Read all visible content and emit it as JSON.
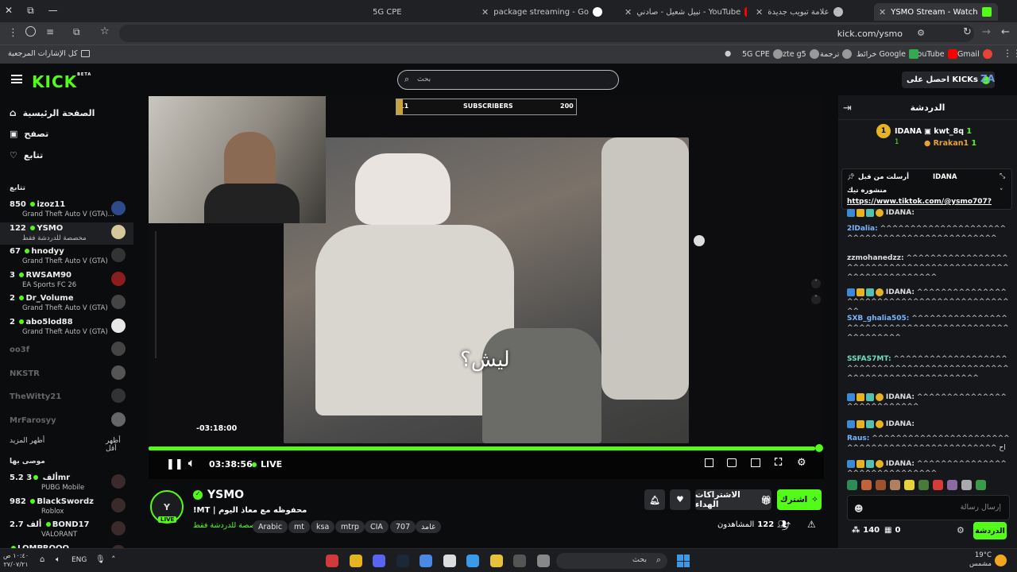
{
  "browser": {
    "tabs": [
      {
        "label": "YSMO Stream - Watch Live",
        "active": true
      },
      {
        "label": "علامة تبويب جديدة"
      },
      {
        "label": "نبيل شعيل - صادني - YouTube"
      },
      {
        "label": "package streaming - Google Se"
      },
      {
        "label": "5G CPE"
      }
    ],
    "url": "kick.com/ysmo",
    "bookmarks": [
      "Gmail",
      "YouTube",
      "خرائط Google",
      "ترجمة",
      "zte g5",
      "5G CPE"
    ],
    "bookmarks_folder": "كل الإشارات المرجعية"
  },
  "header": {
    "logo": "KICK",
    "beta": "BETA",
    "search_placeholder": "بحث",
    "get_kicks": "احصل على KICKs",
    "avatar": "ZA"
  },
  "sidebar": {
    "nav": [
      {
        "label": "الصفحة الرئيسية",
        "icon": "home-icon"
      },
      {
        "label": "تصفح",
        "icon": "browse-icon"
      },
      {
        "label": "تتابع",
        "icon": "heart-icon"
      }
    ],
    "following_title": "تتابع",
    "following": [
      {
        "name": "izoz11",
        "viewers": "850",
        "game": "Grand Theft Auto V (GTA)...",
        "live": true
      },
      {
        "name": "YSMO",
        "viewers": "122",
        "game": "مخصصة للدردشة فقط",
        "live": true,
        "active": true
      },
      {
        "name": "hnodyy",
        "viewers": "67",
        "game": "Grand Theft Auto V (GTA)",
        "live": true
      },
      {
        "name": "RWSAM90",
        "viewers": "3",
        "game": "EA Sports FC 26",
        "live": true
      },
      {
        "name": "Dr_Volume",
        "viewers": "2",
        "game": "Grand Theft Auto V (GTA)",
        "live": true
      },
      {
        "name": "abo5lod88",
        "viewers": "2",
        "game": "Grand Theft Auto V (GTA)",
        "live": true
      },
      {
        "name": "oo3f",
        "live": false
      },
      {
        "name": "NKSTR",
        "live": false
      },
      {
        "name": "TheWitty21",
        "live": false
      },
      {
        "name": "MrFarosyy",
        "live": false
      }
    ],
    "show_more": "أظهر المزيد",
    "show_less": "أظهر أقل",
    "recommended_title": "موصى بها",
    "recommended": [
      {
        "name": "3mr",
        "viewers": "5.2 ألف",
        "game": "PUBG Mobile"
      },
      {
        "name": "BlackSwordz",
        "viewers": "982",
        "game": "Roblox"
      },
      {
        "name": "BOND17",
        "viewers": "2.7 ألف",
        "game": "VALORANT"
      },
      {
        "name": "LOMPROOO",
        "viewers": "",
        "game": ""
      }
    ]
  },
  "player": {
    "subscribers_label": "SUBSCRIBERS",
    "subscribers_count": "11",
    "subscribers_goal": "200",
    "subtitle": "ليش؟",
    "hover_time": "-03:18:00",
    "elapsed": "03:38:56",
    "live_label": "LIVE",
    "progress": 0.99
  },
  "stream": {
    "channel": "YSMO",
    "live_badge": "LIVE",
    "title": "!MT | محفوظه مع معاذ اليوم",
    "category": "مخصصة للدردشة فقط",
    "tags": [
      "Arabic",
      "mt",
      "ksa",
      "mtrp",
      "CIA",
      "707",
      "غامد"
    ],
    "follow_label": "اشترك",
    "gift_label": "الاشتراكات الهداء",
    "viewers_label": "المشاهدون",
    "viewers_count": "122"
  },
  "chat": {
    "title": "الدردشة",
    "leaderboard": [
      {
        "rank": "1",
        "name": "IDANA",
        "count": "1"
      },
      {
        "name": "kwt_8q",
        "count": "1"
      },
      {
        "name": "Rrakan1",
        "count": "1"
      }
    ],
    "pinned": {
      "author": "IDANA",
      "meta": "أرسلت من قبل",
      "text": "منشوره تيك",
      "link": "https://www.tiktok.com/@ysmo707?"
    },
    "messages": [
      {
        "user": "IDANA",
        "text": "",
        "color": "#dddddd"
      },
      {
        "user": "2lDalia",
        "text": "^^^^^^^^^^^^^^^^^^^^^^^^^^^^^^^^^^^^^^^^^^^^^^",
        "color": "#7ab6ff"
      },
      {
        "user": "zzmohanedzz",
        "text": "^^^^^^^^^^^^^^^^^^^^^^^^^^^^^^^^^^^^^^^^^^^^^^^^^^^^^^^^^^^",
        "color": "#dddddd"
      },
      {
        "user": "IDANA",
        "text": "^^^^^^^^^^^^^^^^^^^^^^^^^^^^^^^^^^^^^^^^^^^^",
        "color": "#dddddd"
      },
      {
        "user": "SXB_ghalia505",
        "text": "^^^^^^^^^^^^^^^^^^^^^^^^^^^^^^^^^^^^^^^^^^^^^^^^^^^^",
        "color": "#7ab6ff"
      },
      {
        "user": "SSFAS7MT",
        "text": "^^^^^^^^^^^^^^^^^^^^^^^^^^^^^^^^^^^^^^^^^^^^^^^^^^^^^^^^^^^^^^^^^^^^",
        "color": "#6fe0c0"
      },
      {
        "user": "IDANA",
        "text": "^^^^^^^^^^^^^^^^^^^^^^^^^^^",
        "color": "#dddddd"
      },
      {
        "user": "IDANA",
        "text": "",
        "color": "#dddddd"
      },
      {
        "user": "Raus",
        "text": "^^^^^^^^^^^^^^^^^^^^^^^^^^^^^^^^^^^^^^^^^^^^^^^^ اح",
        "color": "#7ab6ff"
      },
      {
        "user": "IDANA",
        "text": "^^^^^^^^^^^^^^^^^^^^^^^^^^^^^^",
        "color": "#dddddd"
      }
    ],
    "input_placeholder": "إرسال رسالة",
    "send_label": "الدردشة",
    "points": "140",
    "gifts": "0"
  },
  "taskbar": {
    "search_placeholder": "بحث",
    "weather_temp": "19°C",
    "weather_desc": "مشمس",
    "time": "١٠:٤٠ ص",
    "date": "٢٧/٠٧/٢١",
    "lang": "ENG"
  },
  "colors": {
    "kick_green": "#53fc18",
    "bg": "#0b0c0e",
    "chat_bg": "#16171a"
  }
}
